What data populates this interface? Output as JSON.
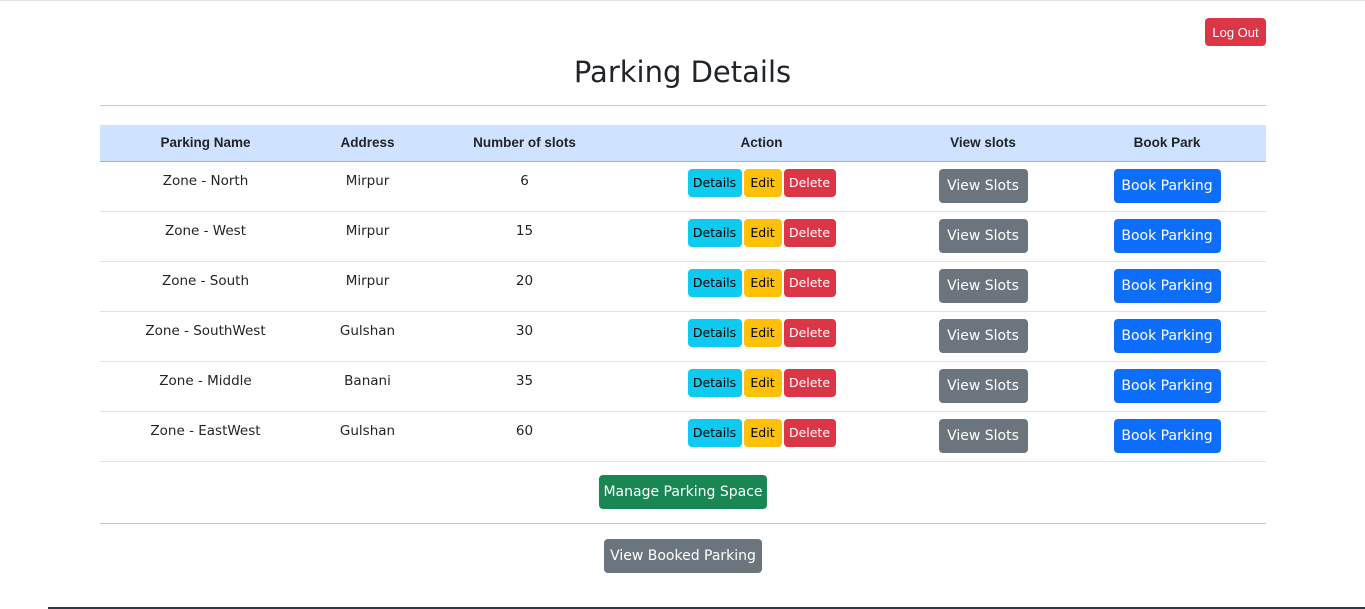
{
  "header": {
    "logout_label": "Log Out",
    "title": "Parking Details"
  },
  "table": {
    "columns": [
      "Parking Name",
      "Address",
      "Number of slots",
      "Action",
      "View slots",
      "Book Park"
    ],
    "rows": [
      {
        "name": "Zone - North",
        "address": "Mirpur",
        "slots": "6"
      },
      {
        "name": "Zone - West",
        "address": "Mirpur",
        "slots": "15"
      },
      {
        "name": "Zone - South",
        "address": "Mirpur",
        "slots": "20"
      },
      {
        "name": "Zone - SouthWest",
        "address": "Gulshan",
        "slots": "30"
      },
      {
        "name": "Zone - Middle",
        "address": "Banani",
        "slots": "35"
      },
      {
        "name": "Zone - EastWest",
        "address": "Gulshan",
        "slots": "60"
      }
    ],
    "buttons": {
      "details": "Details",
      "edit": "Edit",
      "delete": "Delete",
      "view_slots": "View Slots",
      "book_parking": "Book Parking"
    }
  },
  "footer": {
    "manage_label": "Manage Parking Space",
    "booked_label": "View Booked Parking"
  },
  "colors": {
    "header_row": "#cfe2ff",
    "danger": "#dc3545",
    "info": "#0dcaf0",
    "warning": "#ffc107",
    "secondary": "#6c757d",
    "primary": "#0d6efd",
    "success": "#198754"
  }
}
